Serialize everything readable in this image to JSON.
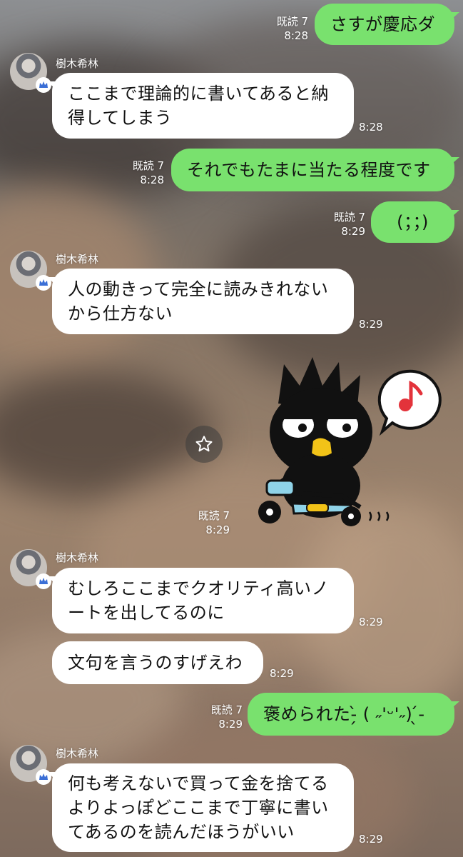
{
  "sender_name": "樹木希林",
  "messages": [
    {
      "id": "m1",
      "side": "right",
      "text": "さすが慶応ダ",
      "read": "既読 7",
      "time": "8:28"
    },
    {
      "id": "m2",
      "side": "left",
      "lines": [
        "ここまで理論的に書いてあると納",
        "得してしまう"
      ],
      "time": "8:28"
    },
    {
      "id": "m3",
      "side": "right",
      "text": "それでもたまに当たる程度です",
      "read": "既読 7",
      "time": "8:28"
    },
    {
      "id": "m4",
      "side": "right",
      "text": "(；；)",
      "read": "既読 7",
      "time": "8:29"
    },
    {
      "id": "m5",
      "side": "left",
      "lines": [
        "人の動きって完全に読みきれない",
        "から仕方ない"
      ],
      "time": "8:29"
    },
    {
      "id": "m6",
      "side": "right",
      "type": "sticker",
      "sticker": "penguin-on-tricycle-sticker",
      "read": "既読 7",
      "time": "8:29"
    },
    {
      "id": "m7",
      "side": "left",
      "lines": [
        "むしろここまでクオリティ高いノ",
        "ートを出してるのに"
      ],
      "time": "8:29"
    },
    {
      "id": "m8",
      "side": "left",
      "text": "文句を言うのすげえわ",
      "time": "8:29"
    },
    {
      "id": "m9",
      "side": "right",
      "text": "褒められた-̗̀ ( ˶'ᵕ'˶) ̖́-",
      "read": "既読 7",
      "time": "8:29"
    },
    {
      "id": "m10",
      "side": "left",
      "lines": [
        "何も考えないで買って金を捨てる",
        "よりよっぽどここまで丁寧に書い",
        "てあるのを読んだほうがいい"
      ],
      "time": "8:29"
    }
  ],
  "colors": {
    "green_bubble": "#79e16e",
    "white_bubble": "#ffffff"
  },
  "icons": {
    "favorite": "star-icon",
    "badge": "crown-icon"
  }
}
